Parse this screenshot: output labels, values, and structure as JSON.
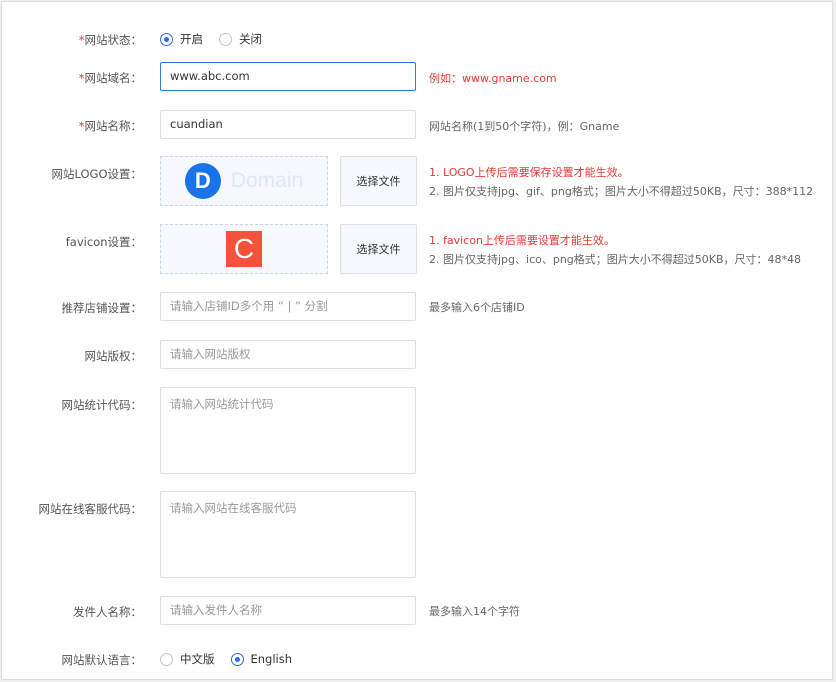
{
  "status": {
    "label": "网站状态：",
    "options": [
      "开启",
      "关闭"
    ],
    "selected": 0
  },
  "domain": {
    "label": "网站域名：",
    "value": "www.abc.com",
    "hint": "例如：www.gname.com"
  },
  "name": {
    "label": "网站名称：",
    "value": "cuandian",
    "hint": "网站名称(1到50个字符)，例：Gname"
  },
  "logo": {
    "label": "网站LOGO设置：",
    "logo_letter": "D",
    "logo_word": "Domain",
    "button": "选择文件",
    "hint1": "1. LOGO上传后需要保存设置才能生效。",
    "hint2": "2. 图片仅支持jpg、gif、png格式；图片大小不得超过50KB，尺寸：388*112"
  },
  "favicon": {
    "label": "favicon设置：",
    "letter": "C",
    "button": "选择文件",
    "hint1": "1. favicon上传后需要设置才能生效。",
    "hint2": "2. 图片仅支持jpg、ico、png格式；图片大小不得超过50KB，尺寸：48*48"
  },
  "shops": {
    "label": "推荐店铺设置：",
    "placeholder": "请输入店铺ID多个用 “ | ” 分割",
    "hint": "最多输入6个店铺ID"
  },
  "copyright": {
    "label": "网站版权：",
    "placeholder": "请输入网站版权"
  },
  "stats_code": {
    "label": "网站统计代码：",
    "placeholder": "请输入网站统计代码"
  },
  "service_code": {
    "label": "网站在线客服代码：",
    "placeholder": "请输入网站在线客服代码"
  },
  "sender": {
    "label": "发件人名称：",
    "placeholder": "请输入发件人名称",
    "hint": "最多输入14个字符"
  },
  "language": {
    "label": "网站默认语言：",
    "options": [
      "中文版",
      "English"
    ],
    "selected": 1
  },
  "colors": {
    "accent": "#2f6be0",
    "required": "#e53935",
    "logo_blue": "#1a73e8",
    "favicon_red": "#f5523c"
  },
  "required_mark": "*"
}
